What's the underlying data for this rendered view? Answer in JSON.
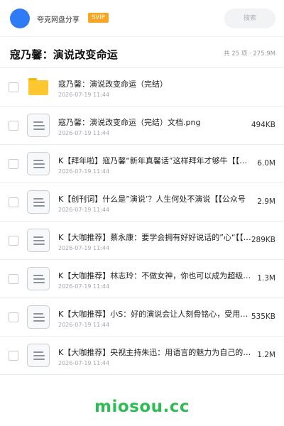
{
  "header": {
    "app_name": "夸克网盘分享",
    "badge": "SVIP",
    "search_placeholder": "搜索",
    "avatar_color": "#2f7bf5",
    "badge_color": "#f6a623"
  },
  "folder": {
    "title": "寇乃馨：演说改变命运",
    "summary": "共 25 项 · 275.9M"
  },
  "files": [
    {
      "name": "寇乃馨：演说改变命运（完结）",
      "date": "2026-07-19 11:44",
      "size": "",
      "icon": "folder-icon"
    },
    {
      "name": "寇乃馨：演说改变命运（完结）文档.png",
      "date": "2026-07-19 11:44",
      "size": "494KB",
      "icon": "file-icon"
    },
    {
      "name": "K【拜年啦】寇乃馨“新年真馨话”这样拜年才够牛【【公众号",
      "date": "2026-07-19 11:44",
      "size": "6.0M",
      "icon": "file-icon"
    },
    {
      "name": "K【创刊词】什么是”演说’？人生何处不演说【【公众号",
      "date": "2026-07-19 11:44",
      "size": "2.9M",
      "icon": "file-icon"
    },
    {
      "name": "K【大咖推荐】蔡永康：要学会拥有好好说话的”心“【【公众号",
      "date": "2026-07-19 11:44",
      "size": "289KB",
      "icon": "file-icon"
    },
    {
      "name": "K【大咖推荐】林志玲：不做女神，你也可以成为超级演说家",
      "date": "2026-07-19 11:44",
      "size": "1.3M",
      "icon": "file-icon"
    },
    {
      "name": "K【大咖推荐】小S：好的演说会让人刻骨铭心，受用无穷",
      "date": "2026-07-19 11:44",
      "size": "535KB",
      "icon": "file-icon"
    },
    {
      "name": "K【大咖推荐】央视主持朱迅：用语言的魅力为自己的未来加分",
      "date": "2026-07-19 11:44",
      "size": "1.2M",
      "icon": "file-icon"
    }
  ],
  "watermark": {
    "text": "miosou.cc",
    "color": "#2ebd54"
  }
}
